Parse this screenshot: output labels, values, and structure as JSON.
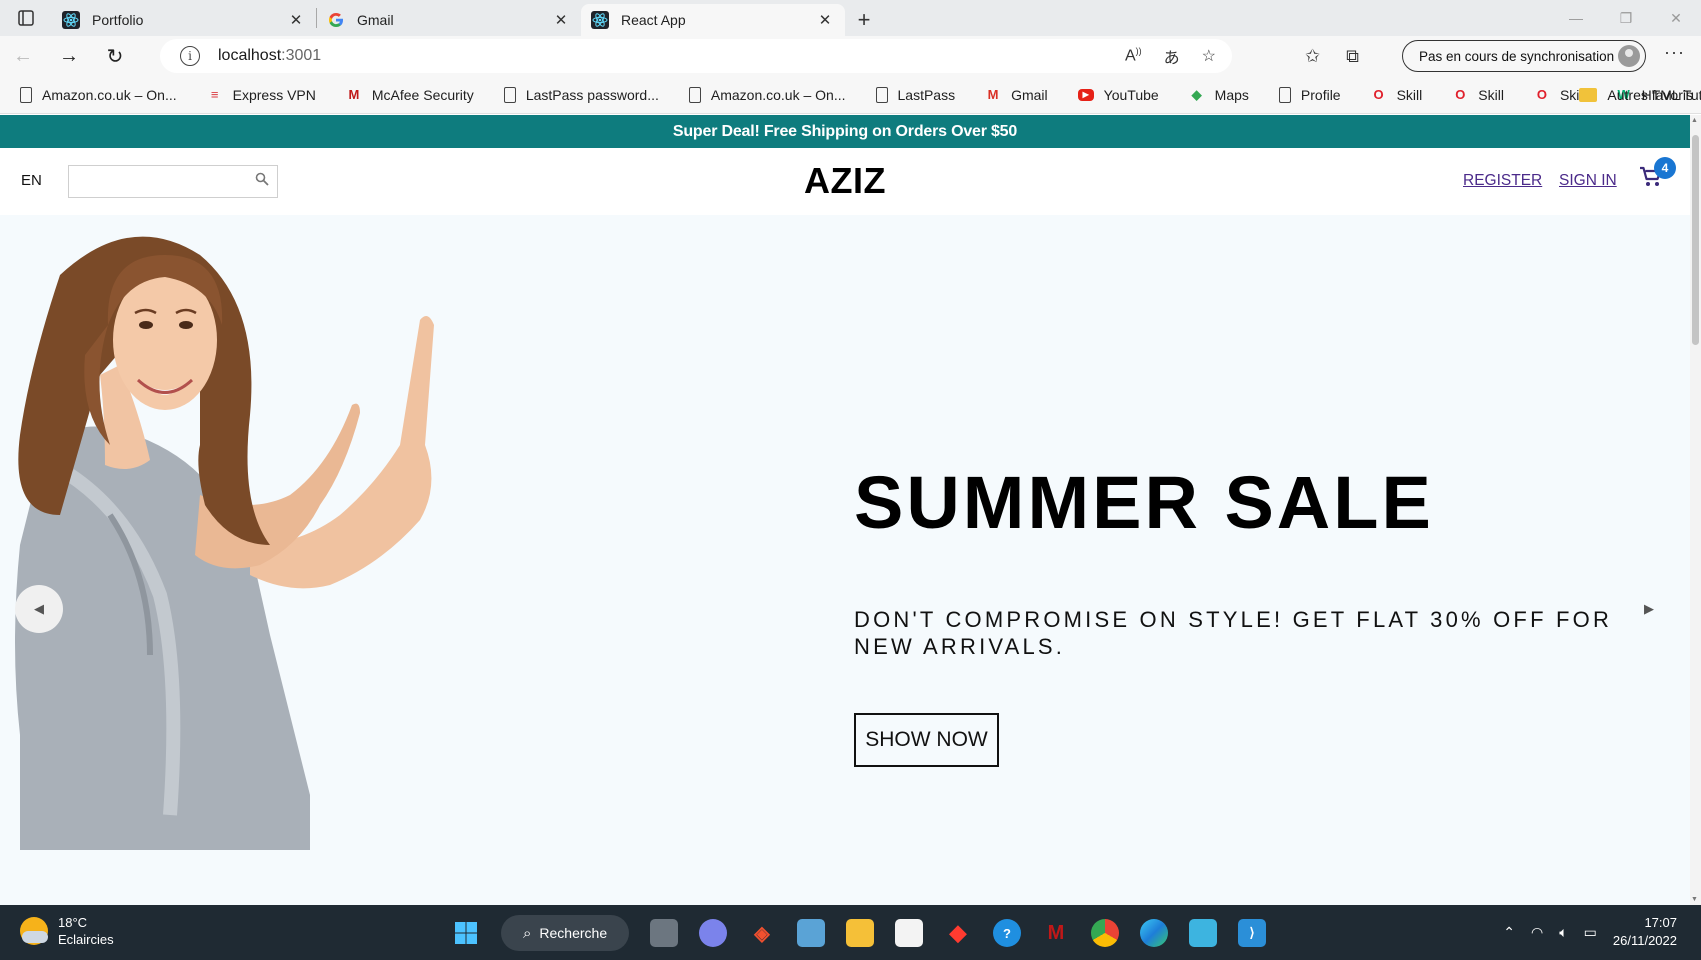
{
  "browser": {
    "tabs": [
      {
        "title": "Portfolio",
        "active": false
      },
      {
        "title": "Gmail",
        "active": false
      },
      {
        "title": "React App",
        "active": true
      }
    ],
    "address": {
      "host": "localhost",
      "port": ":3001"
    },
    "sync_label": "Pas en cours de synchronisation",
    "bookmarks": [
      {
        "label": "Amazon.co.uk – On...",
        "icon": "page-icon"
      },
      {
        "label": "Express VPN",
        "icon": "expressvpn-icon"
      },
      {
        "label": "McAfee Security",
        "icon": "mcafee-icon"
      },
      {
        "label": "LastPass password...",
        "icon": "page-icon"
      },
      {
        "label": "Amazon.co.uk – On...",
        "icon": "page-icon"
      },
      {
        "label": "LastPass",
        "icon": "page-icon"
      },
      {
        "label": "Gmail",
        "icon": "gmail-icon"
      },
      {
        "label": "YouTube",
        "icon": "youtube-icon"
      },
      {
        "label": "Maps",
        "icon": "maps-icon"
      },
      {
        "label": "Profile",
        "icon": "page-icon"
      },
      {
        "label": "Skill",
        "icon": "skill-icon"
      },
      {
        "label": "Skill",
        "icon": "skill-icon"
      },
      {
        "label": "Skill",
        "icon": "skill-icon"
      },
      {
        "label": "HTML Tutorial",
        "icon": "w3schools-icon"
      }
    ],
    "other_favorites": "Autres favoris"
  },
  "page": {
    "announcement": "Super Deal! Free Shipping on Orders Over $50",
    "lang": "EN",
    "search": {
      "value": "",
      "placeholder": ""
    },
    "logo": "AZIZ",
    "nav": {
      "register": "REGISTER",
      "signin": "SIGN IN"
    },
    "cart_count": "4",
    "hero": {
      "title": "SUMMER SALE",
      "description": "DON'T COMPROMISE ON STYLE! GET FLAT 30% OFF FOR NEW ARRIVALS.",
      "button": "SHOW NOW"
    },
    "colors": {
      "announcement_bg": "#0e7c7e",
      "hero_bg": "#f5fafd",
      "link": "#4b2a8a",
      "badge": "#1976d2"
    }
  },
  "taskbar": {
    "weather": {
      "temp": "18°C",
      "condition": "Eclaircies"
    },
    "search_label": "Recherche",
    "time": "17:07",
    "date": "26/11/2022"
  }
}
